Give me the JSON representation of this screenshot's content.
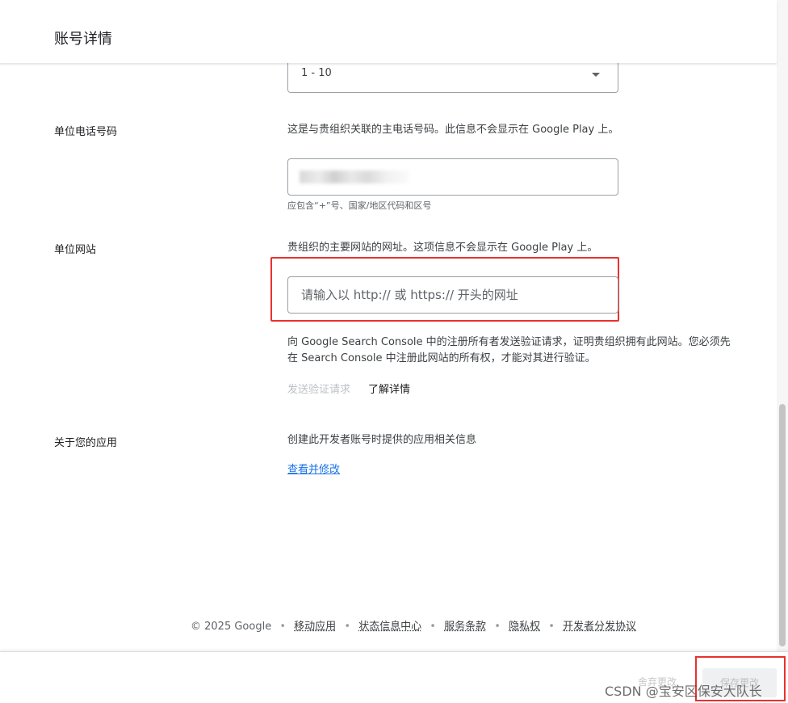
{
  "header": {
    "title": "账号详情"
  },
  "org_size": {
    "selected": "1 - 10"
  },
  "phone": {
    "label": "单位电话号码",
    "description": "这是与贵组织关联的主电话号码。此信息不会显示在 Google Play 上。",
    "hint": "应包含“+”号、国家/地区代码和区号"
  },
  "website": {
    "label": "单位网站",
    "description": "贵组织的主要网站的网址。这项信息不会显示在 Google Play 上。",
    "placeholder": "请输入以 http:// 或 https:// 开头的网址",
    "verify_line1": "向 Google Search Console 中的注册所有者发送验证请求，证明贵组织拥有此网站。您必须先",
    "verify_line2": "在 Search Console 中注册此网站的所有权，才能对其进行验证。",
    "send_verify": "发送验证请求",
    "learn_more": "了解详情"
  },
  "apps": {
    "label": "关于您的应用",
    "description": "创建此开发者账号时提供的应用相关信息",
    "view_edit": "查看并修改"
  },
  "footer": {
    "copyright": "© 2025 Google",
    "links": [
      "移动应用",
      "状态信息中心",
      "服务条款",
      "隐私权",
      "开发者分发协议"
    ]
  },
  "actions": {
    "discard": "舍弃更改",
    "save": "保存更改"
  },
  "watermark": "CSDN @宝安区保安大队长",
  "colors": {
    "highlight": "#e8322e",
    "link": "#1a73e8"
  }
}
